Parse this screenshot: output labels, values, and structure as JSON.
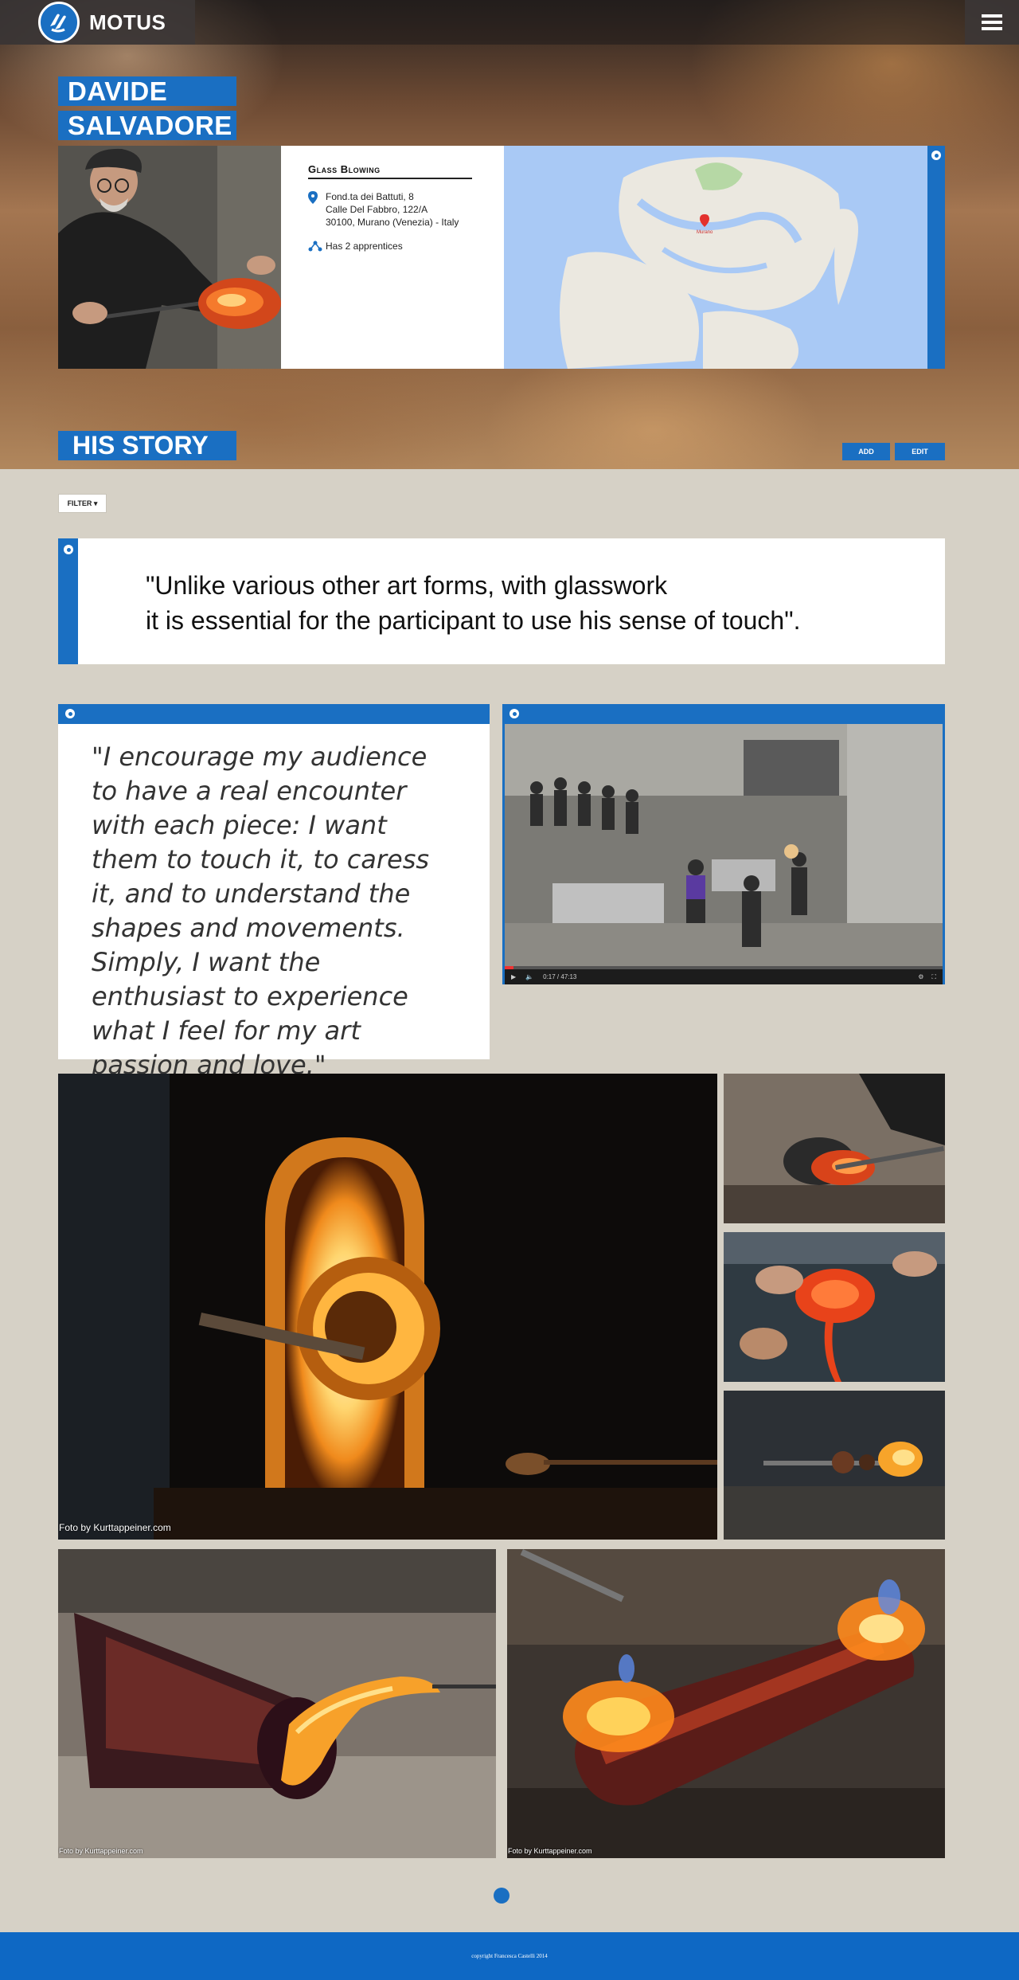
{
  "brand": {
    "name": "MOTUS",
    "logo_icon": "hands-icon"
  },
  "header": {
    "menu_icon": "hamburger-icon"
  },
  "artisan": {
    "first_name": "DAVIDE",
    "last_name": "SALVADORE",
    "craft": "Glass Blowing",
    "address": [
      "Fond.ta dei Battuti, 8",
      "Calle Del Fabbro, 122/A",
      "30100, Murano (Venezia) - Italy"
    ],
    "apprentices": "Has 2 apprentices"
  },
  "map": {
    "pin_label": "Murano"
  },
  "story": {
    "title": "HIS STORY",
    "add_label": "ADD",
    "edit_label": "EDIT",
    "filter_label": "FILTER ▾"
  },
  "quote_main": {
    "line1": "\"Unlike various other art forms, with glasswork",
    "line2": "it is essential for the participant to use his sense of touch\"."
  },
  "quote_secondary": "\"I encourage my audience to have a real encounter with each piece: I want them to touch it, to caress it, and to understand the shapes and movements. Simply, I want the enthusiast to experience what I feel for my art passion and love.\"",
  "video": {
    "time": "0:17 / 47:13",
    "progress": 0.02
  },
  "photos": {
    "credit_large": "Foto by Kurttappeiner.com",
    "credit_small_left": "Foto by Kurttappeiner.com",
    "credit_small_right": "Foto by Kurttappeiner.com"
  },
  "footer": {
    "copyright": "copyright Francesca Castelli 2014"
  },
  "colors": {
    "accent": "#1a6fc2",
    "background": "#d6d1c6"
  }
}
